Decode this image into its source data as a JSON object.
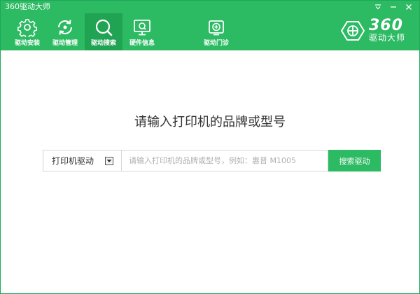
{
  "window": {
    "title": "360驱动大师"
  },
  "nav": {
    "items": [
      {
        "label": "驱动安装",
        "icon": "gear-icon"
      },
      {
        "label": "驱动管理",
        "icon": "refresh-icon"
      },
      {
        "label": "驱动搜索",
        "icon": "search-icon",
        "active": true
      },
      {
        "label": "硬件信息",
        "icon": "monitor-icon"
      },
      {
        "label": "驱动门诊",
        "icon": "clinic-icon"
      }
    ]
  },
  "logo": {
    "number": "360",
    "name": "驱动大师"
  },
  "main": {
    "prompt": "请输入打印机的品牌或型号",
    "type_select": "打印机驱动",
    "search_placeholder": "请输入打印机的品牌或型号，例如：惠普 M1005",
    "search_button": "搜索驱动"
  },
  "colors": {
    "brand_green": "#2cba63",
    "active_tab": "#21a354"
  }
}
